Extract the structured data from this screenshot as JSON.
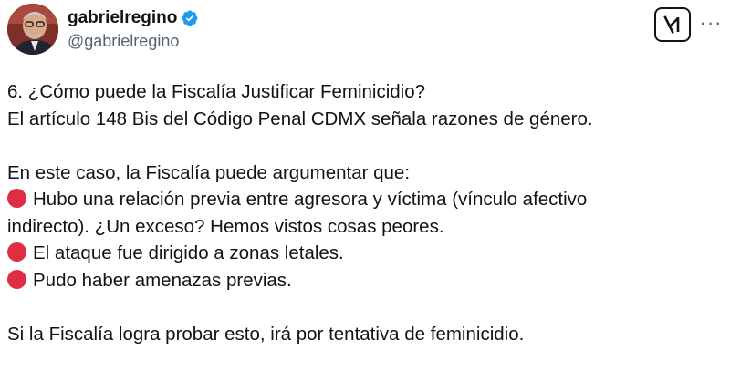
{
  "author": {
    "display_name": "gabrielregino",
    "handle": "@gabrielregino",
    "avatar_icon": "avatar-photo",
    "verified_icon": "verified-badge-icon",
    "verified_color": "#1d9bf0"
  },
  "actions": {
    "grok_icon": "grok-icon",
    "more_icon": "more-options-icon",
    "more_label": "···"
  },
  "tweet": {
    "line1": "6. ¿Cómo puede la Fiscalía Justificar Feminicidio?",
    "line2": "El artículo 148 Bis del Código Penal CDMX señala razones de género.",
    "line3": "En este caso, la Fiscalía puede argumentar que:",
    "bullet1_a": "Hubo una relación previa entre agresora y víctima (vínculo afectivo",
    "bullet1_b": "indirecto). ¿Un exceso? Hemos vistos cosas peores.",
    "bullet2": "El ataque fue dirigido a zonas letales.",
    "bullet3": "Pudo haber amenazas previas.",
    "closing": "Si la Fiscalía logra probar esto, irá por tentativa de feminicidio.",
    "bullet_icon": "red-circle-icon",
    "bullet_color": "#dd2e44"
  }
}
